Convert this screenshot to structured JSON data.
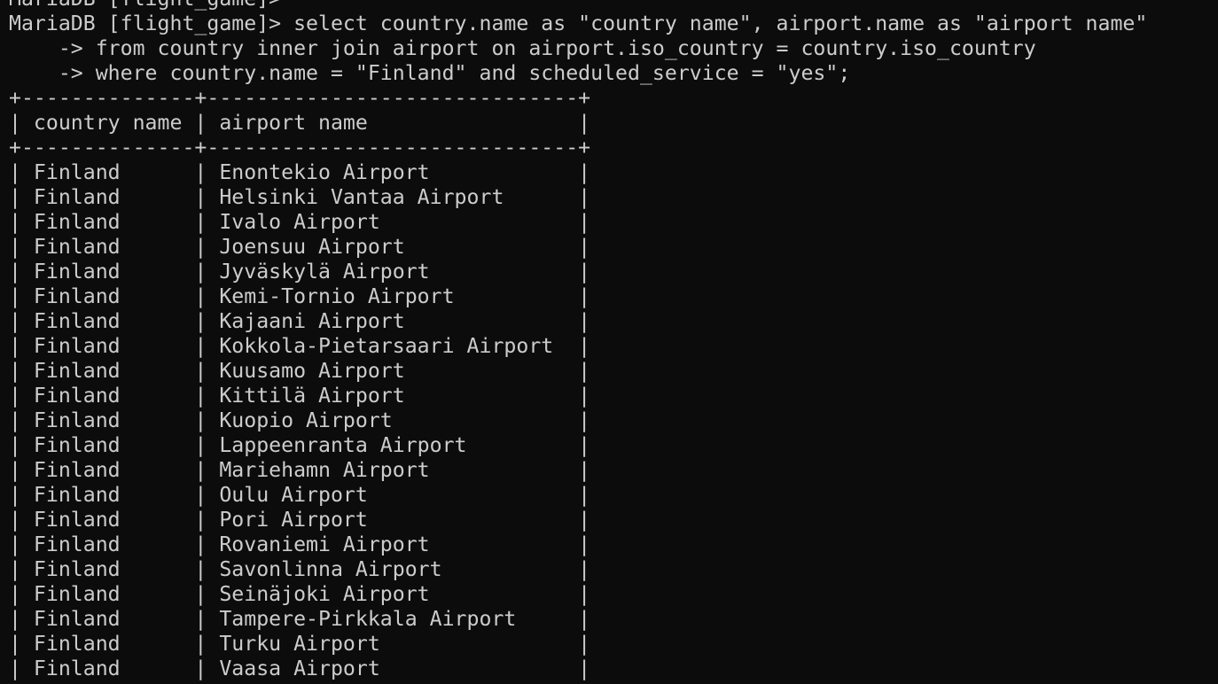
{
  "terminal": {
    "lines": [
      "MariaDB [flight_game]>",
      "MariaDB [flight_game]> select country.name as \"country name\", airport.name as \"airport name\"",
      "    -> from country inner join airport on airport.iso_country = country.iso_country",
      "    -> where country.name = \"Finland\" and scheduled_service = \"yes\";",
      "+--------------+------------------------------+",
      "| country name | airport name                 |",
      "+--------------+------------------------------+",
      "| Finland      | Enontekio Airport            |",
      "| Finland      | Helsinki Vantaa Airport      |",
      "| Finland      | Ivalo Airport                |",
      "| Finland      | Joensuu Airport              |",
      "| Finland      | Jyväskylä Airport            |",
      "| Finland      | Kemi-Tornio Airport          |",
      "| Finland      | Kajaani Airport              |",
      "| Finland      | Kokkola-Pietarsaari Airport  |",
      "| Finland      | Kuusamo Airport              |",
      "| Finland      | Kittilä Airport              |",
      "| Finland      | Kuopio Airport               |",
      "| Finland      | Lappeenranta Airport         |",
      "| Finland      | Mariehamn Airport            |",
      "| Finland      | Oulu Airport                 |",
      "| Finland      | Pori Airport                 |",
      "| Finland      | Rovaniemi Airport            |",
      "| Finland      | Savonlinna Airport           |",
      "| Finland      | Seinäjoki Airport            |",
      "| Finland      | Tampere-Pirkkala Airport     |",
      "| Finland      | Turku Airport                |",
      "| Finland      | Vaasa Airport                |"
    ]
  },
  "colors": {
    "background": "#0c0c0c",
    "text": "#cccccc"
  }
}
